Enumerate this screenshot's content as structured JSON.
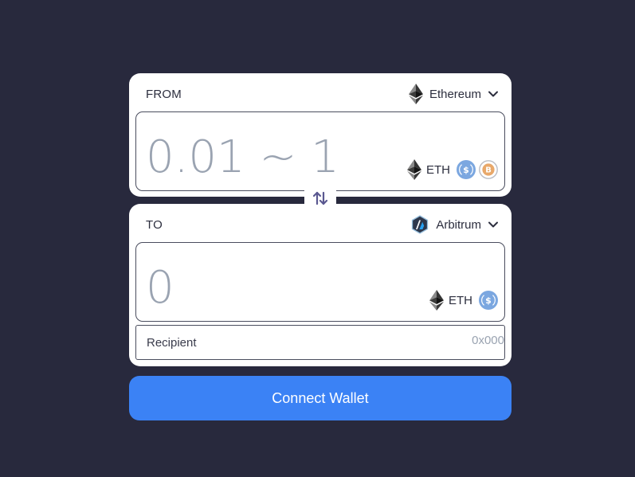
{
  "from": {
    "label": "FROM",
    "chain": {
      "name": "Ethereum",
      "icon": "ethereum-icon"
    },
    "amount_placeholder": "0.01 ~ 1",
    "token": {
      "symbol": "ETH",
      "icon": "ethereum-icon"
    },
    "token_options": [
      "usdc-icon",
      "bitcoin-icon"
    ]
  },
  "to": {
    "label": "TO",
    "chain": {
      "name": "Arbitrum",
      "icon": "arbitrum-icon"
    },
    "amount_placeholder": "0",
    "token": {
      "symbol": "ETH",
      "icon": "ethereum-icon"
    },
    "token_options": [
      "usdc-icon"
    ],
    "recipient": {
      "label": "Recipient",
      "placeholder": "0x000"
    }
  },
  "swap": {
    "icon": "swap-arrows-icon"
  },
  "connect_button": {
    "label": "Connect Wallet"
  },
  "colors": {
    "background": "#28293d",
    "panel": "#ffffff",
    "accent": "#3b82f5",
    "placeholder": "#9aa3b1",
    "usdc": "#7ba7e0",
    "bitcoin": "#e8a86a",
    "swap_icon": "#5a5890"
  }
}
